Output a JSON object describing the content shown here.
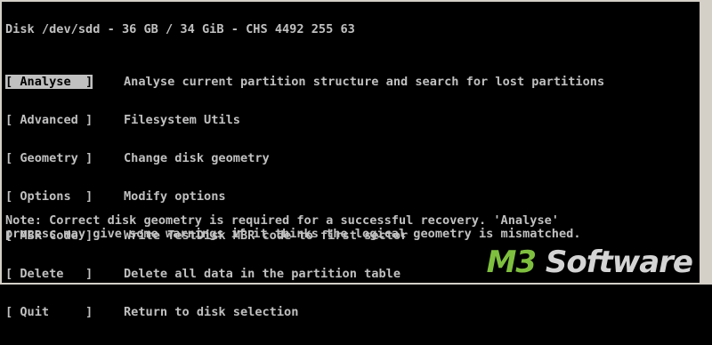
{
  "header": {
    "disk_line": "Disk /dev/sdd - 36 GB / 34 GiB - CHS 4492 255 63"
  },
  "menu": {
    "items": [
      {
        "label": "[ Analyse  ]",
        "desc": "Analyse current partition structure and search for lost partitions",
        "selected": true
      },
      {
        "label": "[ Advanced ]",
        "desc": "Filesystem Utils"
      },
      {
        "label": "[ Geometry ]",
        "desc": "Change disk geometry"
      },
      {
        "label": "[ Options  ]",
        "desc": "Modify options"
      },
      {
        "label": "[ MBR Code ]",
        "desc": "Write TestDisk MBR code to first sector"
      },
      {
        "label": "[ Delete   ]",
        "desc": "Delete all data in the partition table"
      },
      {
        "label": "[ Quit     ]",
        "desc": "Return to disk selection"
      }
    ]
  },
  "note": {
    "line1": "Note: Correct disk geometry is required for a successful recovery. 'Analyse'",
    "line2": "process may give some warnings if it thinks the logical geometry is mismatched."
  },
  "watermark": {
    "prefix": "M3",
    "suffix": " Software"
  },
  "colors": {
    "background": "#000000",
    "text": "#c0c0c0",
    "selected_bg": "#c0c0c0",
    "selected_fg": "#000000",
    "watermark_accent": "#7fbf3f"
  }
}
